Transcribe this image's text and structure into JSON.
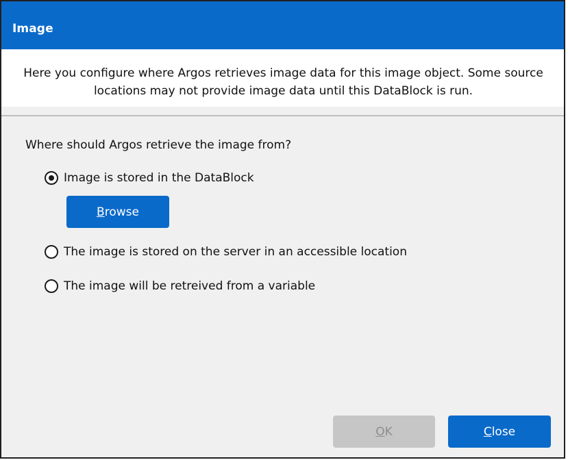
{
  "dialog": {
    "title": "Image",
    "info_text": "Here you configure where Argos retrieves image data for this image object.  Some source locations may not provide image data until this DataBlock is run.",
    "question": "Where should Argos retrieve the image from?",
    "options": [
      {
        "label": "Image is stored in the DataBlock",
        "selected": true
      },
      {
        "label": "The image is stored on the server in an accessible location",
        "selected": false
      },
      {
        "label": "The image will be retreived from a variable",
        "selected": false
      }
    ],
    "browse_button": {
      "mnemonic": "B",
      "rest": "rowse"
    },
    "ok_button": {
      "mnemonic": "O",
      "rest": "K",
      "enabled": false
    },
    "close_button": {
      "mnemonic": "C",
      "rest": "lose"
    }
  },
  "colors": {
    "accent": "#0a6ac9",
    "disabled_button": "#c6c6c6",
    "panel_background": "#f0f0f0"
  }
}
